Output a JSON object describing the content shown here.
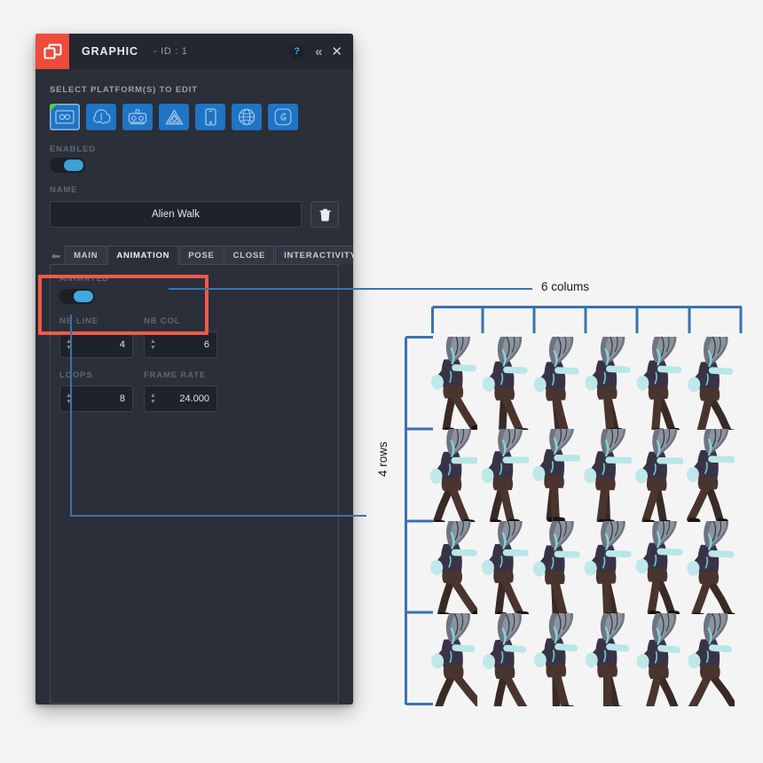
{
  "window": {
    "title": "GRAPHIC",
    "id_label": "- ID : 1",
    "logo_icon": "graphic-layers-icon",
    "help_icon": "?",
    "collapse_icon": "«",
    "close_icon": "✕",
    "accent_red": "#ef4b3a",
    "accent_blue": "#3fa8e0"
  },
  "platforms": {
    "label": "SELECT PLATFORM(S) TO EDIT",
    "items": [
      {
        "name": "platform-html5",
        "selected": true
      },
      {
        "name": "platform-flash",
        "selected": false
      },
      {
        "name": "platform-desktop",
        "selected": false
      },
      {
        "name": "platform-unity",
        "selected": false
      },
      {
        "name": "platform-mobile",
        "selected": false
      },
      {
        "name": "platform-web",
        "selected": false
      },
      {
        "name": "platform-apple",
        "selected": false
      }
    ]
  },
  "enabled": {
    "label": "ENABLED",
    "value": true
  },
  "name": {
    "label": "NAME",
    "value": "Alien Walk",
    "placeholder": "Name",
    "delete_icon": "trash-icon"
  },
  "tabs": {
    "prev_icon": "⬅",
    "next_icon": "➡",
    "items": [
      {
        "label": "MAIN",
        "active": false
      },
      {
        "label": "ANIMATION",
        "active": true
      },
      {
        "label": "POSE",
        "active": false
      },
      {
        "label": "CLOSE",
        "active": false
      },
      {
        "label": "INTERACTIVITY",
        "active": false
      }
    ]
  },
  "animation": {
    "animated": {
      "label": "ANIMATED",
      "value": true
    },
    "fields": [
      {
        "label": "NB LINE",
        "value": "4"
      },
      {
        "label": "NB COL",
        "value": "6"
      },
      {
        "label": "LOOPS",
        "value": "8"
      },
      {
        "label": "FRAME RATE",
        "value": "24.000"
      }
    ]
  },
  "annotations": {
    "columns_label": "6 colums",
    "rows_label": "4 rows",
    "highlight_color": "#f4584a",
    "line_color": "#3a72b0"
  },
  "sprite_sheet": {
    "rows": 4,
    "cols": 6,
    "frame_name": "alien-walk-frame"
  }
}
